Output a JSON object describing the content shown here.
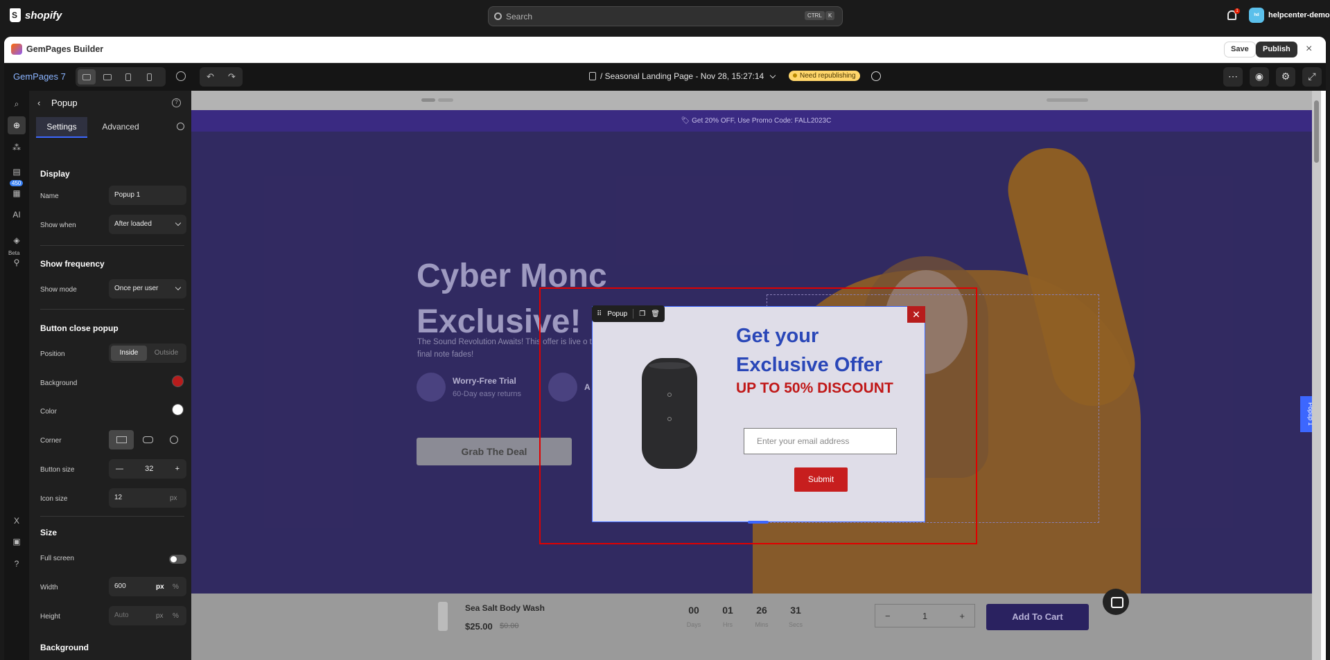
{
  "shopify": {
    "brand": "shopify",
    "search_placeholder": "Search",
    "kbd_ctrl": "CTRL",
    "kbd_k": "K",
    "notif_count": "1",
    "user_initials": "hd",
    "store_name": "helpcenter-demo"
  },
  "app": {
    "title": "GemPages Builder",
    "save_label": "Save",
    "publish_label": "Publish",
    "close_label": "×"
  },
  "editor": {
    "brand": "GemPages 7",
    "undo": "↶",
    "redo": "↷",
    "page_title": "/ Seasonal Landing Page - Nov 28, 15:27:14",
    "status": "Need republishing",
    "more": "⋯",
    "preview": "◉",
    "settings": "⚙",
    "fullscreen": "⤢"
  },
  "rail": {
    "library_count": "450",
    "beta_label": "Beta",
    "ai_label": "AI"
  },
  "panel": {
    "title": "Popup",
    "help": "?",
    "tab_settings": "Settings",
    "tab_advanced": "Advanced",
    "display_title": "Display",
    "name_label": "Name",
    "name_value": "Popup 1",
    "show_when_label": "Show when",
    "show_when_value": "After loaded",
    "frequency_title": "Show frequency",
    "show_mode_label": "Show mode",
    "show_mode_value": "Once per user",
    "close_title": "Button close popup",
    "position_label": "Position",
    "position_inside": "Inside",
    "position_outside": "Outside",
    "background_label": "Background",
    "background_color": "#b71c1c",
    "color_label": "Color",
    "color_value": "#ffffff",
    "corner_label": "Corner",
    "button_size_label": "Button size",
    "button_size_value": "32",
    "icon_size_label": "Icon size",
    "icon_size_value": "12",
    "unit_px": "px",
    "unit_pct": "%",
    "size_title": "Size",
    "full_screen_label": "Full screen",
    "width_label": "Width",
    "width_value": "600",
    "height_label": "Height",
    "height_placeholder": "Auto",
    "bg_title": "Background"
  },
  "canvas": {
    "promo": "Get 20% OFF, Use Promo Code: FALL2023C",
    "headline_1": "Cyber Monc",
    "headline_2": "Exclusive!",
    "subtext": "The Sound Revolution Awaits! This offer is live o the final note fades!",
    "feature1_title": "Worry-Free Trial",
    "feature1_sub": "60-Day easy returns",
    "feature2_title": "A",
    "cta": "Grab The Deal",
    "side_tab": "Popup 1"
  },
  "popup": {
    "toolbar_label": "Popup",
    "close": "✕",
    "heading_line1": "Get  your",
    "heading_line2": "Exclusive Offer",
    "discount": "UP TO 50% DISCOUNT",
    "email_placeholder": "Enter your email address",
    "submit": "Submit"
  },
  "sticky_bar": {
    "product": "Sea Salt Body Wash",
    "price": "$25.00",
    "old_price": "$0.00",
    "countdown": [
      {
        "value": "00",
        "label": "Days"
      },
      {
        "value": "01",
        "label": "Hrs"
      },
      {
        "value": "26",
        "label": "Mins"
      },
      {
        "value": "31",
        "label": "Secs"
      }
    ],
    "qty_minus": "−",
    "qty_value": "1",
    "qty_plus": "+",
    "add_to_cart": "Add To Cart"
  }
}
